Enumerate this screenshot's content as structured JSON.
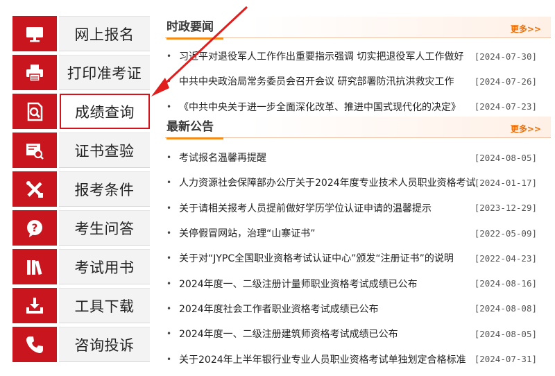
{
  "colors": {
    "accent_red": "#c9151e",
    "accent_orange": "#f06c00",
    "highlight_border": "#d4141c"
  },
  "sidebar": {
    "items": [
      {
        "label": "网上报名",
        "icon": "monitor-icon"
      },
      {
        "label": "打印准考证",
        "icon": "printer-icon"
      },
      {
        "label": "成绩查询",
        "icon": "search-document-icon",
        "active": true
      },
      {
        "label": "证书查验",
        "icon": "certificate-search-icon"
      },
      {
        "label": "报考条件",
        "icon": "tools-icon"
      },
      {
        "label": "考生问答",
        "icon": "question-bubble-icon"
      },
      {
        "label": "考试用书",
        "icon": "books-icon"
      },
      {
        "label": "工具下载",
        "icon": "download-tray-icon"
      },
      {
        "label": "咨询投诉",
        "icon": "phone-icon"
      }
    ]
  },
  "politics": {
    "title": "时政要闻",
    "more": "更多>>",
    "items": [
      {
        "title": "习近平对退役军人工作作出重要指示强调 切实把退役军人工作做好",
        "date": "[2024-07-30]"
      },
      {
        "title": "中共中央政治局常务委员会召开会议 研究部署防汛抗洪救灾工作",
        "date": "[2024-07-26]"
      },
      {
        "title": "《中共中央关于进一步全面深化改革、推进中国式现代化的决定》",
        "date": "[2024-07-23]"
      }
    ]
  },
  "notices": {
    "title": "最新公告",
    "more": "更多>>",
    "items": [
      {
        "title": "考试报名温馨再提醒",
        "date": "[2024-08-05]"
      },
      {
        "title": "人力资源社会保障部办公厅关于2024年度专业技术人员职业资格考试",
        "date": "[2024-01-17]"
      },
      {
        "title": "关于请相关报考人员提前做好学历学位认证申请的温馨提示",
        "date": "[2023-12-29]"
      },
      {
        "title": "关停假冒网站，治理“山寨证书”",
        "date": "[2022-05-09]"
      },
      {
        "title": "关于对“JYPC全国职业资格考试认证中心”颁发“注册证书”的说明",
        "date": "[2022-04-23]"
      },
      {
        "title": "2024年度一、二级注册计量师职业资格考试成绩已公布",
        "date": "[2024-08-16]"
      },
      {
        "title": "2024年度社会工作者职业资格考试成绩已公布",
        "date": "[2024-08-08]"
      },
      {
        "title": "2024年度一、二级注册建筑师资格考试成绩已公布",
        "date": "[2024-08-05]"
      },
      {
        "title": "关于2024年上半年银行业专业人员职业资格考试单独划定合格标准",
        "date": "[2024-07-31]"
      }
    ]
  }
}
